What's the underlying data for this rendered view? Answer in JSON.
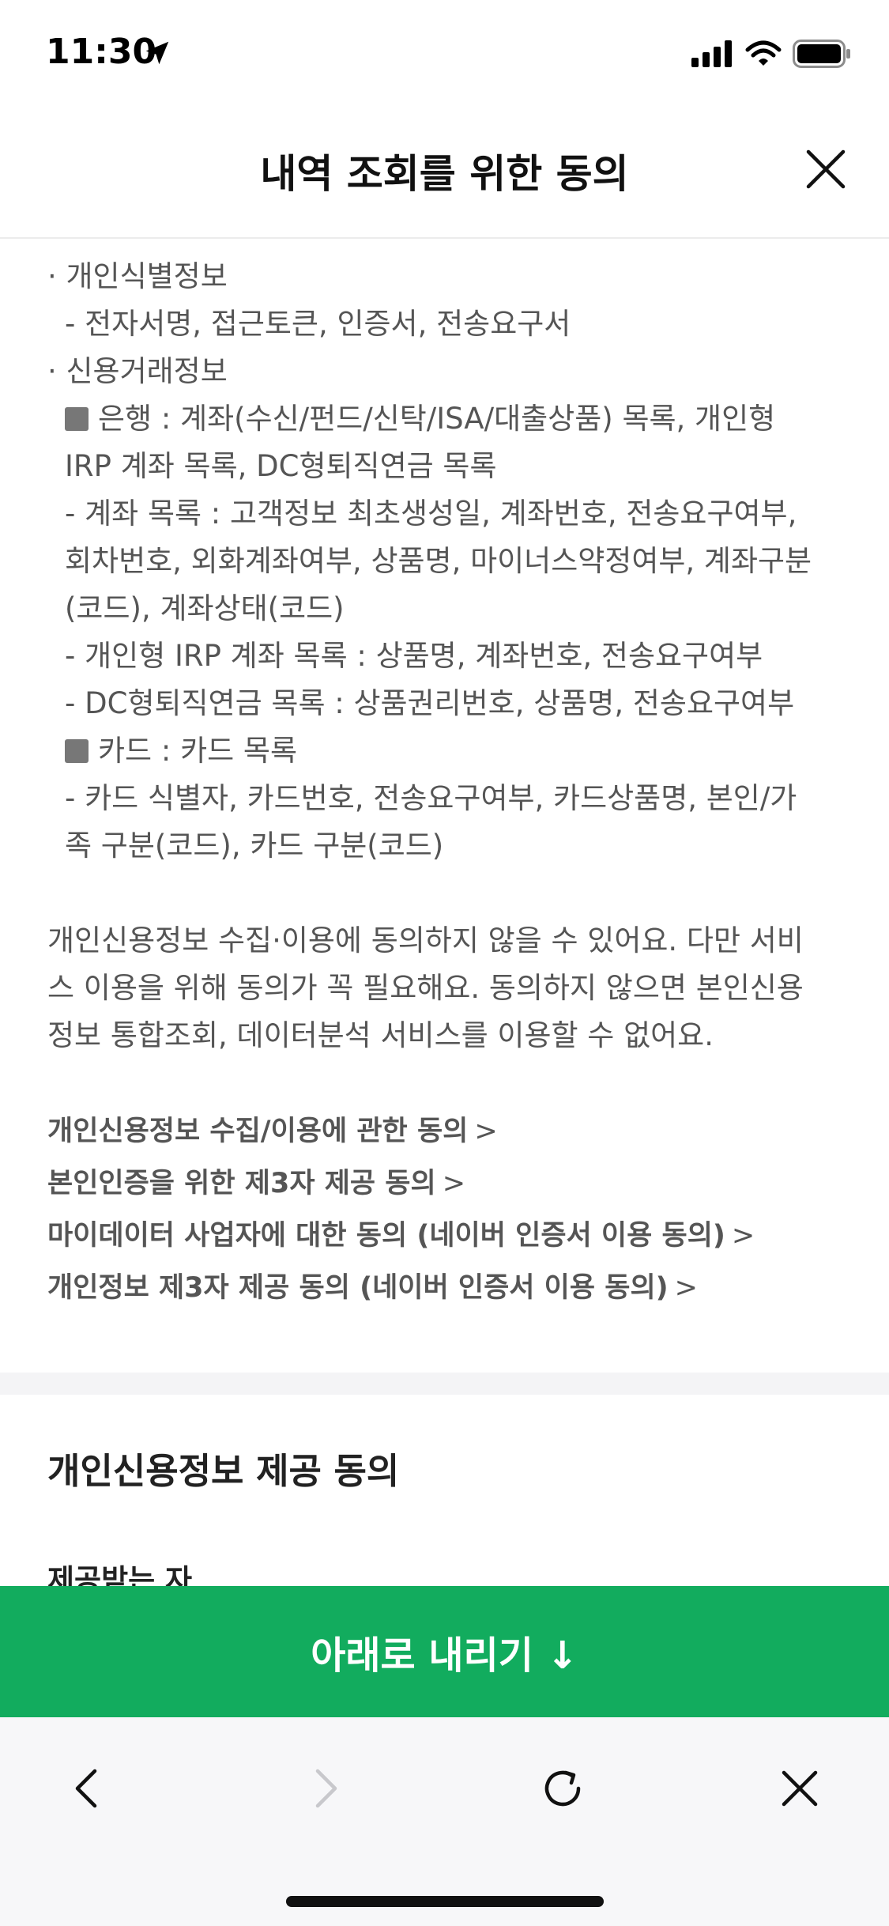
{
  "status_bar": {
    "time": "11:30"
  },
  "header": {
    "title": "내역 조회를 위한 동의"
  },
  "content": {
    "lines": [
      {
        "text": "· 개인식별정보",
        "indent": false,
        "square": false
      },
      {
        "text": "- 전자서명, 접근토큰, 인증서, 전송요구서",
        "indent": true,
        "square": false
      },
      {
        "text": "· 신용거래정보",
        "indent": false,
        "square": false
      },
      {
        "text": "은행 : 계좌(수신/펀드/신탁/ISA/대출상품) 목록, 개인형",
        "indent": true,
        "square": true
      },
      {
        "text": "IRP 계좌 목록, DC형퇴직연금 목록",
        "indent": true,
        "square": false
      },
      {
        "text": "- 계좌 목록 : 고객정보 최초생성일, 계좌번호, 전송요구여부,",
        "indent": true,
        "square": false
      },
      {
        "text": "회차번호, 외화계좌여부, 상품명, 마이너스약정여부, 계좌구분",
        "indent": true,
        "square": false
      },
      {
        "text": "(코드), 계좌상태(코드)",
        "indent": true,
        "square": false
      },
      {
        "text": "- 개인형 IRP 계좌 목록 : 상품명, 계좌번호, 전송요구여부",
        "indent": true,
        "square": false
      },
      {
        "text": "- DC형퇴직연금 목록 : 상품권리번호, 상품명, 전송요구여부",
        "indent": true,
        "square": false
      },
      {
        "text": "카드 : 카드 목록",
        "indent": true,
        "square": true
      },
      {
        "text": "- 카드 식별자, 카드번호, 전송요구여부, 카드상품명, 본인/가",
        "indent": true,
        "square": false
      },
      {
        "text": "족 구분(코드), 카드 구분(코드)",
        "indent": true,
        "square": false
      }
    ],
    "paragraph": [
      "개인신용정보 수집·이용에 동의하지 않을 수 있어요. 다만 서비",
      "스 이용을 위해 동의가 꼭 필요해요. 동의하지 않으면 본인신용",
      "정보 통합조회, 데이터분석 서비스를 이용할 수 없어요."
    ],
    "links": [
      "개인신용정보 수집/이용에 관한 동의",
      "본인인증을 위한 제3자 제공 동의",
      "마이데이터 사업자에 대한 동의 (네이버 인증서 이용 동의)",
      "개인정보 제3자 제공 동의 (네이버 인증서 이용 동의)"
    ],
    "link_chevron": ">"
  },
  "section": {
    "title": "개인신용정보 제공 동의",
    "subtitle": "제공받는 자"
  },
  "scroll_button": {
    "label": "아래로 내리기 ↓"
  },
  "colors": {
    "accent": "#12ac5e",
    "text": "#555555"
  },
  "toolbar": {
    "icons": [
      "back-icon",
      "forward-icon",
      "reload-icon",
      "close-icon"
    ]
  }
}
